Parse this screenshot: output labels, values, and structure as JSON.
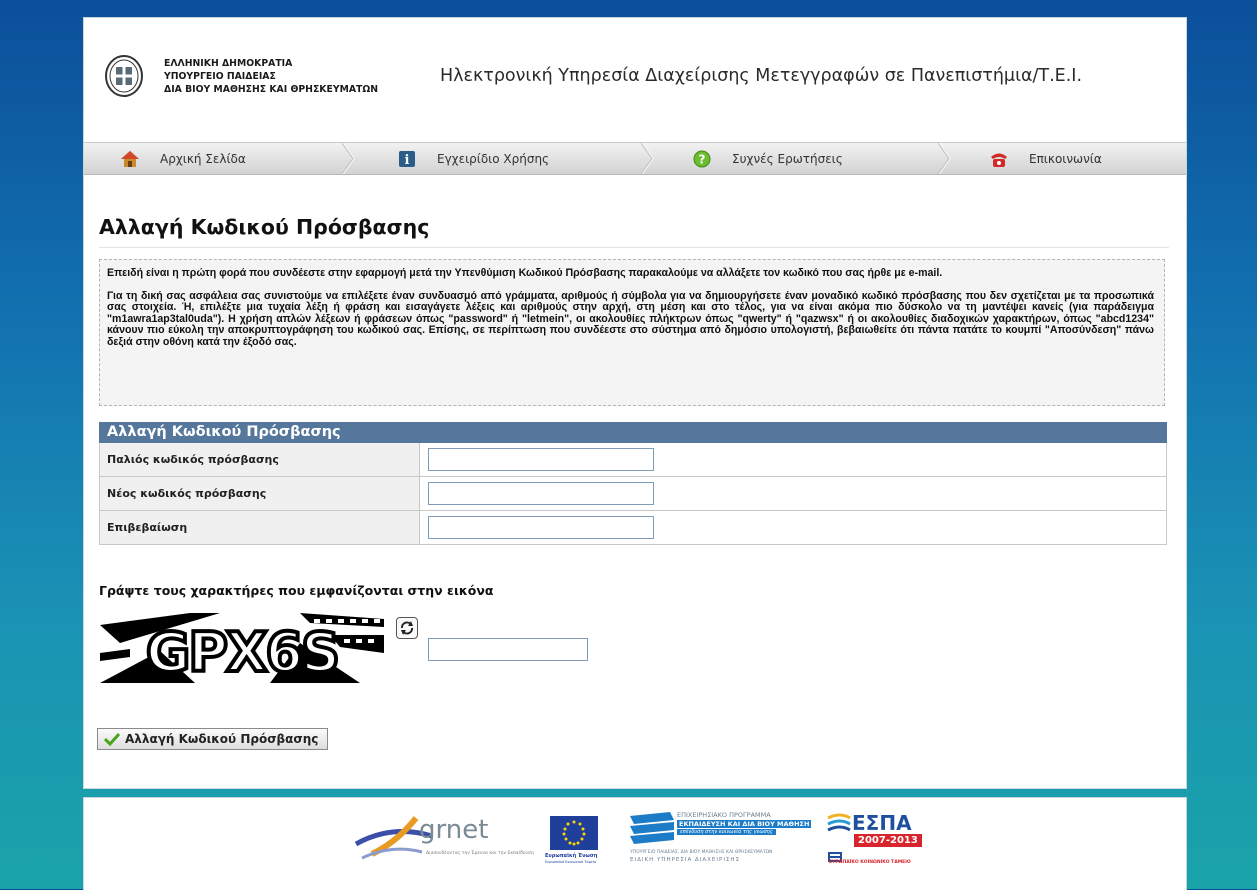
{
  "header": {
    "ministry_lines": [
      "ΕΛΛΗΝΙΚΗ ΔΗΜΟΚΡΑΤΙΑ",
      "ΥΠΟΥΡΓΕΙΟ ΠΑΙΔΕΙΑΣ",
      "ΔΙΑ ΒΙΟΥ ΜΑΘΗΣΗΣ ΚΑΙ ΘΡΗΣΚΕΥΜΑΤΩΝ"
    ],
    "site_title": "Ηλεκτρονική Υπηρεσία Διαχείρισης Μετεγγραφών σε Πανεπιστήμια/Τ.Ε.Ι."
  },
  "nav": {
    "items": [
      {
        "label": "Αρχική Σελίδα",
        "icon": "home-icon"
      },
      {
        "label": "Εγχειρίδιο Χρήσης",
        "icon": "info-icon"
      },
      {
        "label": "Συχνές Ερωτήσεις",
        "icon": "question-icon"
      },
      {
        "label": "Επικοινωνία",
        "icon": "phone-icon"
      }
    ]
  },
  "page": {
    "title": "Αλλαγή Κωδικού Πρόσβασης",
    "notice_p1": "Επειδή είναι η πρώτη φορά που συνδέεστε στην εφαρμογή μετά την Υπενθύμιση Κωδικού Πρόσβασης παρακαλούμε να αλλάξετε τον κωδικό που σας ήρθε με e-mail.",
    "notice_p2": "Για τη δική σας ασφάλεια σας συνιστούμε να επιλέξετε έναν συνδυασμό από γράμματα, αριθμούς ή σύμβολα για να δημιουργήσετε έναν μοναδικό κωδικό πρόσβασης που δεν σχετίζεται με τα προσωπικά σας στοιχεία. Ή, επιλέξτε μια τυχαία λέξη ή φράση και εισαγάγετε λέξεις και αριθμούς στην αρχή, στη μέση και στο τέλος, για να είναι ακόμα πιο δύσκολο να τη μαντέψει κανείς (για παράδειγμα \"m1awra1ap3tal0uda\"). Η χρήση απλών λέξεων ή φράσεων όπως \"password\" ή \"letmein\", οι ακολουθίες πλήκτρων όπως \"qwerty\" ή \"qazwsx\" ή οι ακολουθίες διαδοχικών χαρακτήρων, όπως \"abcd1234\" κάνουν πιο εύκολη την αποκρυπτογράφηση του κωδικού σας. Επίσης, σε περίπτωση που συνδέεστε στο σύστημα από δημόσιο υπολογιστή, βεβαιωθείτε ότι πάντα πατάτε το κουμπί \"Αποσύνδεση\" πάνω δεξιά στην οθόνη κατά την έξοδό σας."
  },
  "form": {
    "header": "Αλλαγή Κωδικού Πρόσβασης",
    "old_password_label": "Παλιός κωδικός πρόσβασης",
    "old_password_value": "",
    "new_password_label": "Νέος κωδικός πρόσβασης",
    "new_password_value": "",
    "confirm_label": "Επιβεβαίωση",
    "confirm_value": ""
  },
  "captcha": {
    "label": "Γράψτε τους χαρακτήρες που εμφανίζονται στην εικόνα",
    "image_text": "GPX6S",
    "input_value": ""
  },
  "submit": {
    "label": "Αλλαγή Κωδικού Πρόσβασης"
  },
  "footer": {
    "grnet_name": "grnet",
    "grnet_tagline": "Διασυνδέοντας την Έρευνα και την Εκπαίδευση",
    "eu_label": "Ευρωπαϊκή Ένωση",
    "eu_sub": "Ευρωπαϊκό Κοινωνικό Ταμείο",
    "program_line1": "ΕΠΙΧΕΙΡΗΣΙΑΚΟ ΠΡΟΓΡΑΜΜΑ",
    "program_line2": "ΕΚΠΑΙΔΕΥΣΗ ΚΑΙ ΔΙΑ ΒΙΟΥ ΜΑΘΗΣΗ",
    "program_line3": "επένδυση στην κοινωνία της γνώσης",
    "program_line4": "ΥΠΟΥΡΓΕΙΟ ΠΑΙΔΕΙΑΣ, ΔΙΑ ΒΙΟΥ ΜΑΘΗΣΗΣ ΚΑΙ ΘΡΗΣΚΕΥΜΑΤΩΝ",
    "program_line5": "ΕΙΔΙΚΗ ΥΠΗΡΕΣΙΑ ΔΙΑΧΕΙΡΙΣΗΣ",
    "espa_name": "ΕΣΠΑ",
    "espa_years": "2007-2013",
    "espa_sub": "ΕΥΡΩΠΑΪΚΟ ΚΟΙΝΩΝΙΚΟ ΤΑΜΕΙΟ"
  }
}
